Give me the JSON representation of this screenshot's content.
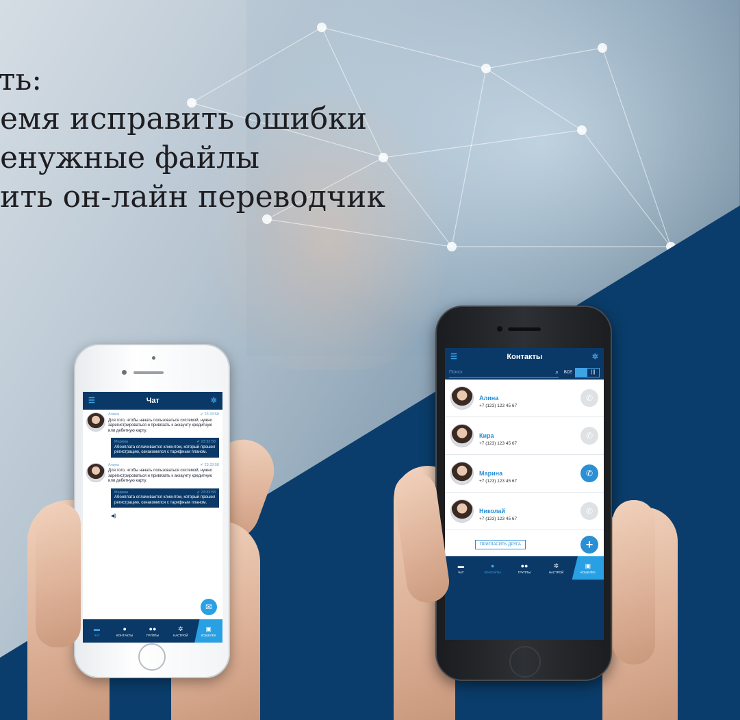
{
  "headline": {
    "line1": "ть:",
    "line2": "емя исправить ошибки",
    "line3": "енужные файлы",
    "line4": "ить он-лайн переводчик"
  },
  "colors": {
    "navy": "#0a3968",
    "accent": "#2aa0e4",
    "bg_triangle": "#0a3d6b"
  },
  "chat_app": {
    "title": "Чат",
    "menu_icon": "hamburger-icon",
    "settings_icon": "gear-icon",
    "messages": [
      {
        "dir": "in",
        "author": "Алина",
        "time": "23:33:58",
        "text": "Для того, чтобы начать пользоваться системой, нужно зарегистрироваться и привязать к аккаунту кредитную или дебетную карту."
      },
      {
        "dir": "out",
        "author": "Марина",
        "time": "23:33:58",
        "text": "Абонплата оплачивается клиентом, который прошел регистрацию, ознакомился с тарифным планом."
      },
      {
        "dir": "in",
        "author": "Алина",
        "time": "23:33:58",
        "text": "Для того, чтобы начать пользоваться системой, нужно зарегистрироваться и привязать к аккаунту кредитную или дебетную карту."
      },
      {
        "dir": "out",
        "author": "Марина",
        "time": "23:33:58",
        "text": "Абонплата оплачивается клиентом, который прошел регистрацию, ознакомился с тарифным планом."
      }
    ],
    "tabs": [
      {
        "label": "ЧАТ",
        "icon": "chat-icon",
        "active": true
      },
      {
        "label": "КОНТАКТЫ",
        "icon": "person-icon",
        "active": false
      },
      {
        "label": "ГРУППЫ",
        "icon": "group-icon",
        "active": false
      },
      {
        "label": "НАСТРОЙ",
        "icon": "gear-icon",
        "active": false
      },
      {
        "label": "КОШЕЛЕК",
        "icon": "wallet-icon",
        "active": false
      }
    ]
  },
  "contacts_app": {
    "title": "Контакты",
    "search_placeholder": "Поиск",
    "filter_all": "ВСЕ",
    "contacts": [
      {
        "name": "Алина",
        "phone": "+7 (123) 123 45 67",
        "call_active": false
      },
      {
        "name": "Кира",
        "phone": "+7 (123) 123 45 67",
        "call_active": false
      },
      {
        "name": "Марина",
        "phone": "+7 (123) 123 45 67",
        "call_active": true
      },
      {
        "name": "Николай",
        "phone": "+7 (123) 123 45 67",
        "call_active": false
      }
    ],
    "invite_label": "ПРИГЛАСИТЬ ДРУГА",
    "tabs": [
      {
        "label": "ЧАТ",
        "icon": "chat-icon",
        "active": false
      },
      {
        "label": "КОНТАКТЫ",
        "icon": "person-icon",
        "active": true
      },
      {
        "label": "ГРУППЫ",
        "icon": "group-icon",
        "active": false
      },
      {
        "label": "НАСТРОЙ",
        "icon": "gear-icon",
        "active": false
      },
      {
        "label": "КОШЕЛЕК",
        "icon": "wallet-icon",
        "active": false
      }
    ]
  }
}
